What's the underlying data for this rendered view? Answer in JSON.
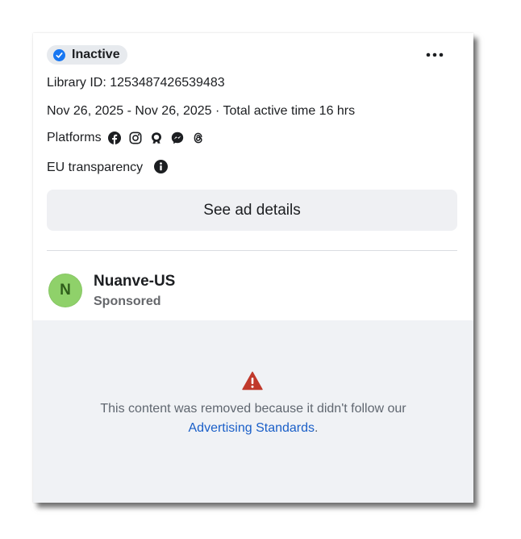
{
  "status": {
    "label": "Inactive",
    "icon": "check-badge-icon",
    "color": "#1877f2"
  },
  "more_menu": {
    "icon": "more-horizontal-icon"
  },
  "library_id": "Library ID: 1253487426539483",
  "date_range": "Nov 26, 2025 - Nov 26, 2025 · Total active time 16 hrs",
  "platforms": {
    "label": "Platforms",
    "icons": [
      "facebook-icon",
      "instagram-icon",
      "audience-network-icon",
      "messenger-icon",
      "threads-icon"
    ]
  },
  "eu_transparency": {
    "label": "EU transparency",
    "icon": "info-icon"
  },
  "details_button": "See ad details",
  "advertiser": {
    "initial": "N",
    "name": "Nuanve-US",
    "subtitle": "Sponsored",
    "avatar_color": "#8fd16a"
  },
  "removed_notice": {
    "icon": "warning-icon",
    "icon_color": "#c0392b",
    "text_prefix": "This content was removed because it didn't follow our ",
    "link": "Advertising Standards",
    "text_suffix": "."
  }
}
